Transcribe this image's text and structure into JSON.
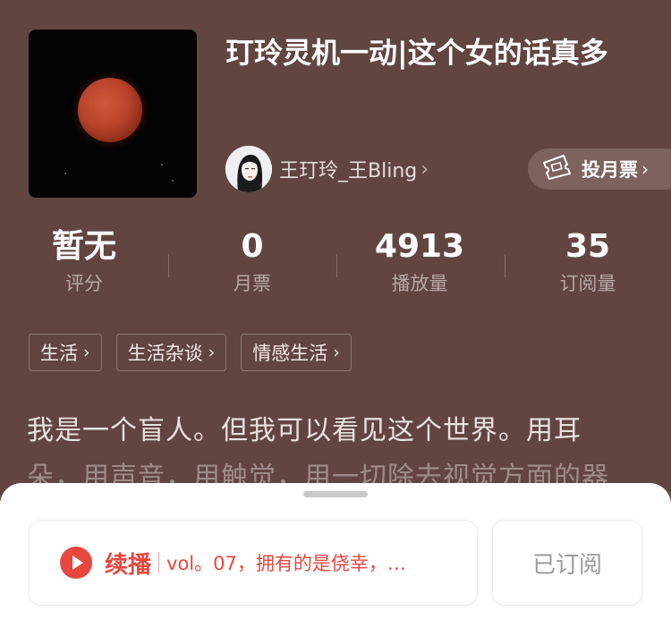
{
  "podcast": {
    "title": "玎玲灵机一动|这个女的话真多",
    "author_name": "王玎玲_王Bling",
    "author_chevron": "›",
    "vote_label": "投月票",
    "vote_chevron": "›"
  },
  "stats": [
    {
      "value": "暂无",
      "label": "评分"
    },
    {
      "value": "0",
      "label": "月票"
    },
    {
      "value": "4913",
      "label": "播放量"
    },
    {
      "value": "35",
      "label": "订阅量"
    }
  ],
  "tags": [
    {
      "label": "生活",
      "chevron": "›"
    },
    {
      "label": "生活杂谈",
      "chevron": "›"
    },
    {
      "label": "情感生活",
      "chevron": "›"
    }
  ],
  "description": {
    "line1": "我是一个盲人。但我可以看见这个世界。用耳",
    "line2": "朵，用声音，用触觉，用一切除去视觉方面的器"
  },
  "player": {
    "continue_label": "续播",
    "episode_title": "vol。07，拥有的是侥幸，…",
    "subscribed_label": "已订阅"
  },
  "colors": {
    "background": "#624540",
    "accent": "#e8473f",
    "sheet": "#ffffff"
  },
  "icons": {
    "cover": "moon-cover-image",
    "avatar": "author-avatar",
    "vote": "ticket-icon",
    "play": "play-icon"
  }
}
